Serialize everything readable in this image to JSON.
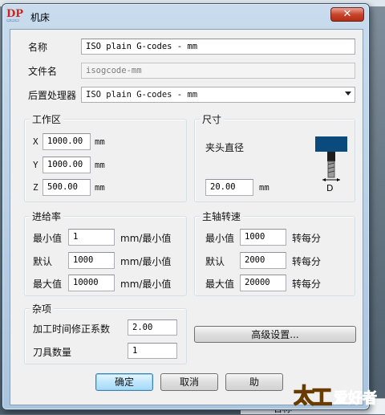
{
  "window": {
    "title": "机床",
    "close_glyph": "✕",
    "logo": "DP"
  },
  "fields": {
    "name_label": "名称",
    "name_value": "ISO plain G-codes - mm",
    "file_label": "文件名",
    "file_value": "isogcode-mm",
    "post_label": "后置处理器",
    "post_value": "ISO plain G-codes - mm"
  },
  "workarea": {
    "title": "工作区",
    "x_label": "X",
    "x_value": "1000.00",
    "y_label": "Y",
    "y_value": "1000.00",
    "z_label": "Z",
    "z_value": "500.00",
    "unit": "mm"
  },
  "size": {
    "title": "尺寸",
    "chuck_label": "夹头直径",
    "chuck_value": "20.00",
    "unit": "mm",
    "diagram_letter": "D"
  },
  "feed": {
    "title": "进给率",
    "min_label": "最小值",
    "min_value": "1",
    "def_label": "默认",
    "def_value": "1000",
    "max_label": "最大值",
    "max_value": "10000",
    "unit": "mm/最小值"
  },
  "spindle": {
    "title": "主轴转速",
    "min_label": "最小值",
    "min_value": "1000",
    "def_label": "默认",
    "def_value": "2000",
    "max_label": "最大值",
    "max_value": "20000",
    "unit": "转每分"
  },
  "misc": {
    "title": "杂项",
    "time_label": "加工时间修正系数",
    "time_value": "2.00",
    "tools_label": "刀具数量",
    "tools_value": "1"
  },
  "buttons": {
    "advanced": "高级设置...",
    "ok": "确定",
    "cancel": "取消",
    "help": "助"
  },
  "background": {
    "status_text": "名称"
  },
  "watermark": {
    "text": "太平爱好者"
  }
}
